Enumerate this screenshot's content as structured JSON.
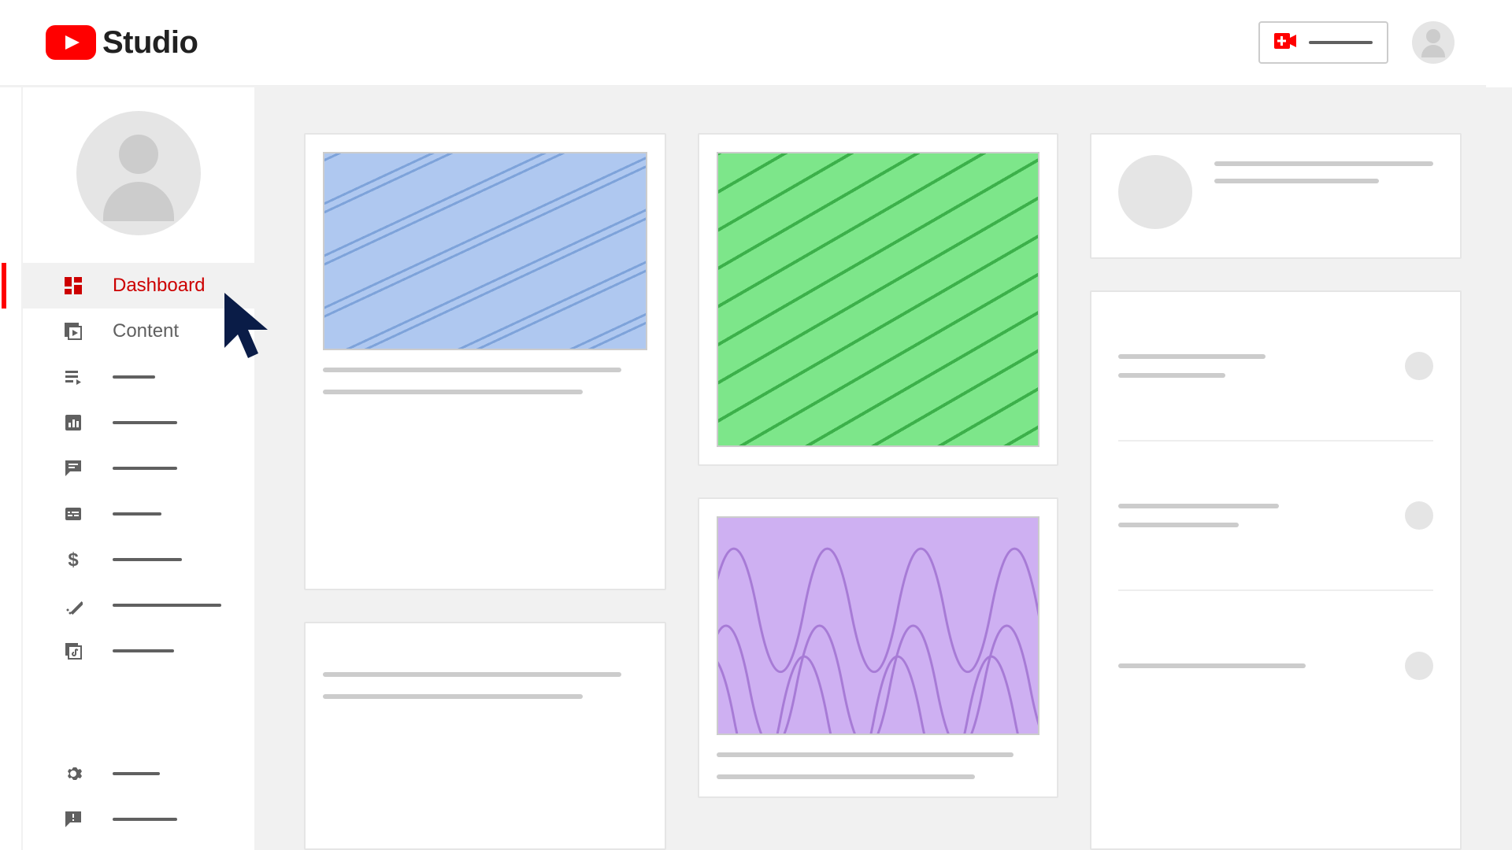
{
  "header": {
    "product_name": "Studio",
    "brand_color": "#ff0000"
  },
  "sidebar": {
    "items": [
      {
        "id": "dashboard",
        "label": "Dashboard",
        "icon": "dashboard-icon",
        "active": true
      },
      {
        "id": "content",
        "label": "Content",
        "icon": "content-icon",
        "active": false
      },
      {
        "id": "playlists",
        "label": "",
        "icon": "playlist-icon",
        "stub_w": 54
      },
      {
        "id": "analytics",
        "label": "",
        "icon": "analytics-icon",
        "stub_w": 82
      },
      {
        "id": "comments",
        "label": "",
        "icon": "comments-icon",
        "stub_w": 82
      },
      {
        "id": "subtitles",
        "label": "",
        "icon": "subtitles-icon",
        "stub_w": 62
      },
      {
        "id": "monetization",
        "label": "",
        "icon": "dollar-icon",
        "stub_w": 88
      },
      {
        "id": "customization",
        "label": "",
        "icon": "magic-icon",
        "stub_w": 138
      },
      {
        "id": "audio",
        "label": "",
        "icon": "audio-icon",
        "stub_w": 78
      }
    ],
    "bottom_items": [
      {
        "id": "settings",
        "label": "",
        "icon": "gear-icon",
        "stub_w": 60
      },
      {
        "id": "feedback",
        "label": "",
        "icon": "feedback-icon",
        "stub_w": 82
      }
    ]
  }
}
